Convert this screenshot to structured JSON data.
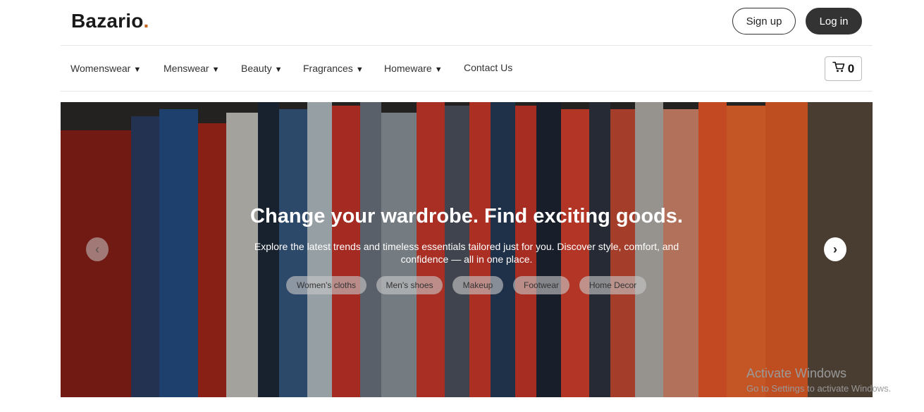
{
  "header": {
    "logo_text": "Bazario",
    "logo_dot": ".",
    "signup_label": "Sign up",
    "login_label": "Log in"
  },
  "nav": {
    "items": [
      {
        "label": "Womenswear",
        "caret": "▼"
      },
      {
        "label": "Menswear",
        "caret": "▼"
      },
      {
        "label": "Beauty",
        "caret": "▼"
      },
      {
        "label": "Fragrances",
        "caret": "▼"
      },
      {
        "label": "Homeware",
        "caret": "▼"
      },
      {
        "label": "Contact Us",
        "caret": ""
      }
    ],
    "cart_count": "0"
  },
  "hero": {
    "title": "Change your wardrobe. Find exciting goods.",
    "subtitle": "Explore the latest trends and timeless essentials tailored just for you. Discover style, comfort, and confidence — all in one place.",
    "chips": [
      "Women's cloths",
      "Men's shoes",
      "Makeup",
      "Footwear",
      "Home Decor"
    ],
    "prev_arrow": "‹",
    "next_arrow": "›"
  },
  "watermark": {
    "title": "Activate Windows",
    "subtitle": "Go to Settings to activate Windows."
  },
  "colors": {
    "accent": "#c8641e",
    "dark_button": "#333333",
    "border": "#e6e6e6"
  },
  "icons": {
    "cart": "cart-icon"
  }
}
